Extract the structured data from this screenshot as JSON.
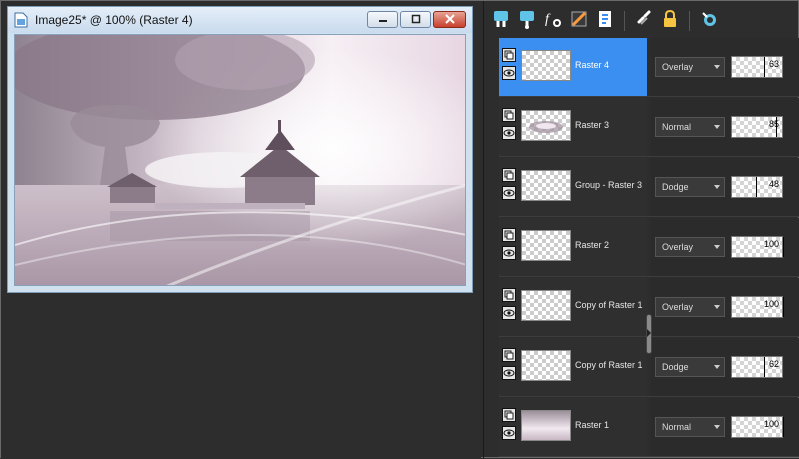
{
  "window": {
    "title": "Image25* @ 100% (Raster 4)",
    "buttons": {
      "minimize": "minimize-icon",
      "maximize": "maximize-icon",
      "close": "close-icon"
    }
  },
  "toolbar": {
    "icons": [
      "new-raster-layer-icon",
      "new-vector-layer-icon",
      "layer-styles-icon",
      "mask-icon",
      "layer-properties-icon",
      "link-icon",
      "lock-icon",
      "more-options-icon"
    ]
  },
  "colors": {
    "selected": "#3b8ff0",
    "panel": "#2d2d2d"
  },
  "layers": [
    {
      "name": "Raster 4",
      "blend": "Overlay",
      "opacity": "63",
      "selected": true,
      "thumb": "transparent"
    },
    {
      "name": "Raster 3",
      "blend": "Normal",
      "opacity": "85",
      "selected": false,
      "thumb": "blot"
    },
    {
      "name": "Group - Raster 3",
      "blend": "Dodge",
      "opacity": "48",
      "selected": false,
      "thumb": "transparent"
    },
    {
      "name": "Raster 2",
      "blend": "Overlay",
      "opacity": "100",
      "selected": false,
      "thumb": "transparent"
    },
    {
      "name": "Copy of Raster 1",
      "blend": "Overlay",
      "opacity": "100",
      "selected": false,
      "thumb": "transparent"
    },
    {
      "name": "Copy of Raster 1",
      "blend": "Dodge",
      "opacity": "62",
      "selected": false,
      "thumb": "transparent"
    },
    {
      "name": "Raster 1",
      "blend": "Normal",
      "opacity": "100",
      "selected": false,
      "thumb": "gradient"
    }
  ]
}
